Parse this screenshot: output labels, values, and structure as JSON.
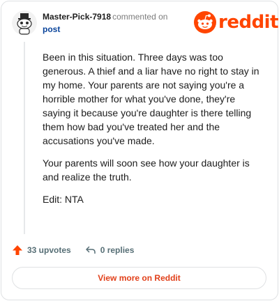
{
  "comment": {
    "username": "Master-Pick-7918",
    "commented_text": "commented on",
    "post_link": "post",
    "paragraphs": [
      "Been in this situation. Three days was too generous. A thief and a liar have no right to stay in my home. Your parents are not saying you're a horrible mother for what you've done, they're saying it because you're daughter is there telling them how bad you've treated her and the accusations you've made.",
      "Your parents will soon see how your daughter is and realize the truth.",
      "Edit: NTA"
    ]
  },
  "brand": {
    "wordmark": "reddit",
    "color": "#ff4500"
  },
  "actions": {
    "upvotes": "33 upvotes",
    "replies": "0 replies",
    "upvote_icon": "upvote-arrow-icon",
    "reply_icon": "reply-arrow-icon"
  },
  "cta": {
    "label": "View more on Reddit",
    "color": "#e1401a"
  }
}
